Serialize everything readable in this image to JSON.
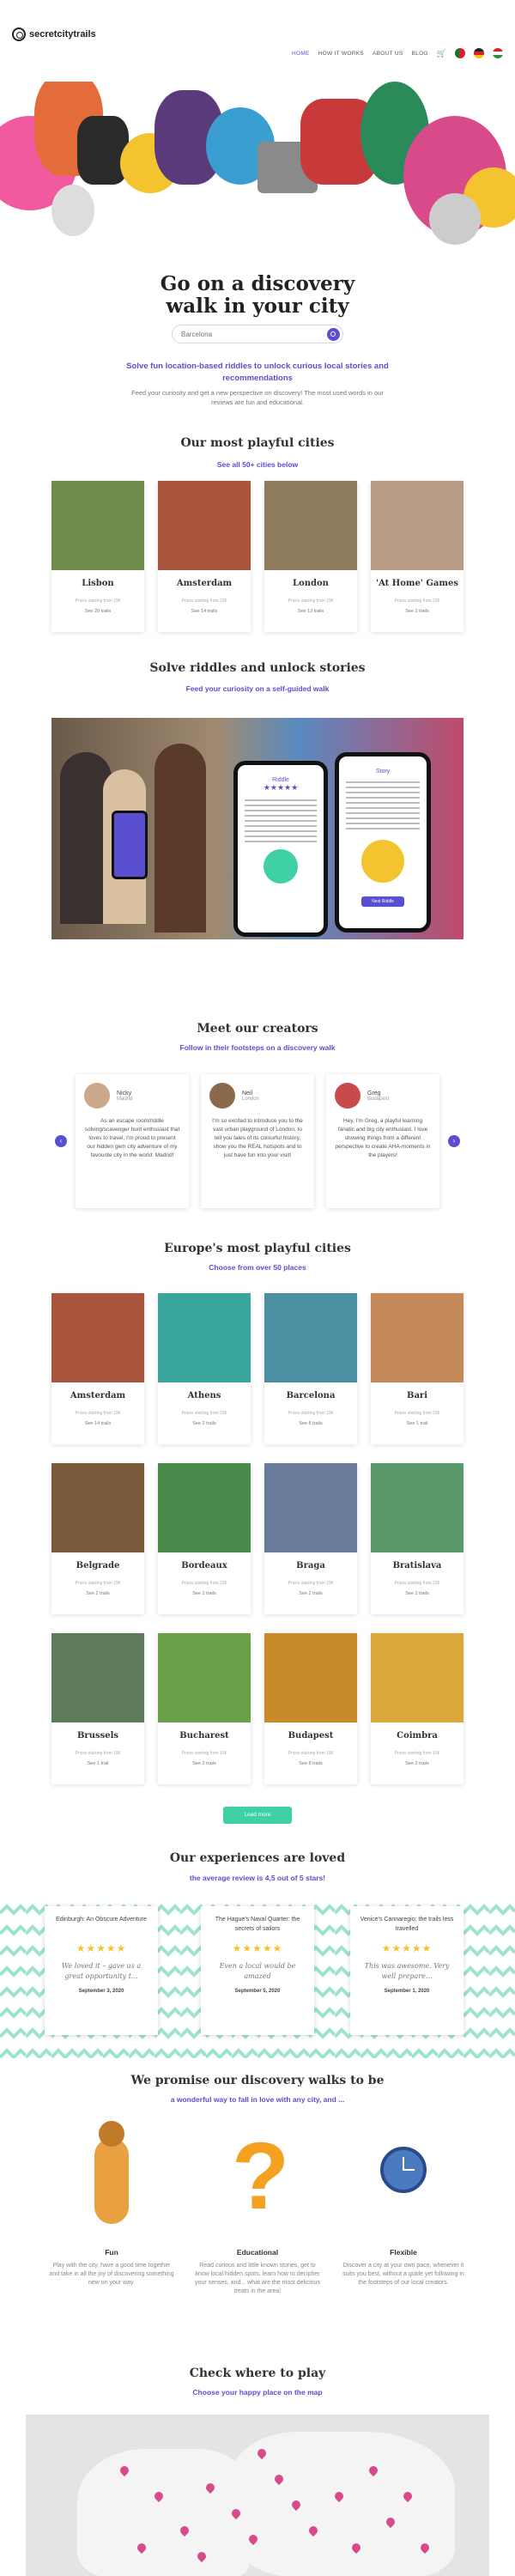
{
  "header": {
    "logo_text": "secretcitytrails",
    "nav": [
      {
        "label": "HOME",
        "active": true
      },
      {
        "label": "HOW IT WORKS",
        "active": false
      },
      {
        "label": "ABOUT US",
        "active": false
      },
      {
        "label": "BLOG",
        "active": false
      }
    ],
    "cart_icon": "cart-icon",
    "flags": [
      "portugal-flag",
      "germany-flag",
      "hungary-flag"
    ]
  },
  "hero": {
    "title_line1": "Go on a discovery",
    "title_line2": "walk in your city",
    "search_placeholder": "Barcelona",
    "subtitle": "Solve fun location-based riddles to unlock curious local stories and recommendations",
    "description": "Feed your curiosity and get a new perspective on discovery! The most used words in our reviews are fun and educational."
  },
  "playful": {
    "title": "Our most playful cities",
    "link": "See all 50+ cities below",
    "cities": [
      {
        "name": "Lisbon",
        "small": "Prices starting from 19€",
        "link": "See 20 trails",
        "color": "#6f8a4a"
      },
      {
        "name": "Amsterdam",
        "small": "Prices starting from 19€",
        "link": "See 14 trails",
        "color": "#a9553d"
      },
      {
        "name": "London",
        "small": "Prices starting from 19€",
        "link": "See 13 trails",
        "color": "#8d7b5c"
      },
      {
        "name": "'At Home' Games",
        "small": "Prices starting from 19€",
        "link": "See 2 trails",
        "color": "#b89c86"
      }
    ]
  },
  "riddles": {
    "title": "Solve riddles and unlock stories",
    "subtitle": "Feed your curiosity on a self-guided walk",
    "phone_left_label": "Riddle",
    "phone_right_label": "Story",
    "phone_right_button": "Next Riddle"
  },
  "creators": {
    "title": "Meet our creators",
    "subtitle": "Follow in their footsteps on a discovery walk",
    "people": [
      {
        "name": "Nicky",
        "city": "Madrid",
        "text": "As an escape room/riddle solving/scavenger hunt enthusiast that loves to travel, I'm proud to present our hidden gem city adventure of my favourite city in the world: Madrid!"
      },
      {
        "name": "Neil",
        "city": "London",
        "text": "I'm so excited to introduce you to the vast urban playground of London, to tell you tales of its colourful history, show you the REAL hotspots and to just have fun into your visit!"
      },
      {
        "name": "Greg",
        "city": "Budapest",
        "text": "Hey, I'm Greg, a playful learning fanatic and big city enthusiast. I love showing things from a different perspective to create AHA-moments in the players!"
      }
    ]
  },
  "europe": {
    "title": "Europe's most playful cities",
    "subtitle": "Choose from over 50 places",
    "load_more": "Load more",
    "cities": [
      {
        "name": "Amsterdam",
        "small": "Prices starting from 19€",
        "link": "See 14 trails",
        "color": "#a9553d"
      },
      {
        "name": "Athens",
        "small": "Prices starting from 19€",
        "link": "See 2 trails",
        "color": "#3aa59c"
      },
      {
        "name": "Barcelona",
        "small": "Prices starting from 19€",
        "link": "See 8 trails",
        "color": "#4c8fa0"
      },
      {
        "name": "Bari",
        "small": "Prices starting from 19€",
        "link": "See 1 trail",
        "color": "#c58a5a"
      },
      {
        "name": "Belgrade",
        "small": "Prices starting from 19€",
        "link": "See 2 trails",
        "color": "#7a5a3a"
      },
      {
        "name": "Bordeaux",
        "small": "Prices starting from 19€",
        "link": "See 2 trails",
        "color": "#4a8a4a"
      },
      {
        "name": "Braga",
        "small": "Prices starting from 19€",
        "link": "See 2 trails",
        "color": "#6a7a9a"
      },
      {
        "name": "Bratislava",
        "small": "Prices starting from 19€",
        "link": "See 2 trails",
        "color": "#5a9a6a"
      },
      {
        "name": "Brussels",
        "small": "Prices starting from 19€",
        "link": "See 1 trail",
        "color": "#5d7a5a"
      },
      {
        "name": "Bucharest",
        "small": "Prices starting from 19€",
        "link": "See 2 trails",
        "color": "#6aa04a"
      },
      {
        "name": "Budapest",
        "small": "Prices starting from 19€",
        "link": "See 8 trails",
        "color": "#c98a2a"
      },
      {
        "name": "Coimbra",
        "small": "Prices starting from 19€",
        "link": "See 2 trails",
        "color": "#d9a73a"
      }
    ]
  },
  "reviews": {
    "title": "Our experiences are loved",
    "subtitle": "the average review is 4,5 out of 5 stars!",
    "items": [
      {
        "title": "Edinburgh: An Obscure Adventure",
        "stars": "★★★★★",
        "text": "We loved it – gave us a great opportunity t...",
        "date": "September 3, 2020"
      },
      {
        "title": "The Hague's Naval Quarter: the secrets of sailors",
        "stars": "★★★★★",
        "text": "Even a local would be amazed",
        "date": "September 5, 2020"
      },
      {
        "title": "Venice's Cannaregio: the trails less travelled",
        "stars": "★★★★★",
        "text": "This was awesome. Very well prepare...",
        "date": "September 1, 2020"
      }
    ]
  },
  "promise": {
    "title": "We promise our discovery walks to be",
    "subtitle": "a wonderful way to fall in love with any city, and ...",
    "items": [
      {
        "title": "Fun",
        "text": "Play with the city, have a good time together and take in all the joy of discovering something new on your way."
      },
      {
        "title": "Educational",
        "text": "Read curious and little known stories, get to know local hidden spots, learn how to decipher your senses, and... what are the most delicious treats in the area!"
      },
      {
        "title": "Flexible",
        "text": "Discover a city at your own pace, whenever it suits you best, without a guide yet following in the footsteps of our local creators."
      }
    ]
  },
  "map_section": {
    "title": "Check where to play",
    "subtitle": "Choose your happy place on the map"
  },
  "colors": {
    "accent": "#5a4fd0",
    "green": "#3fd1a5",
    "zigzag": "#9fe3d1"
  }
}
